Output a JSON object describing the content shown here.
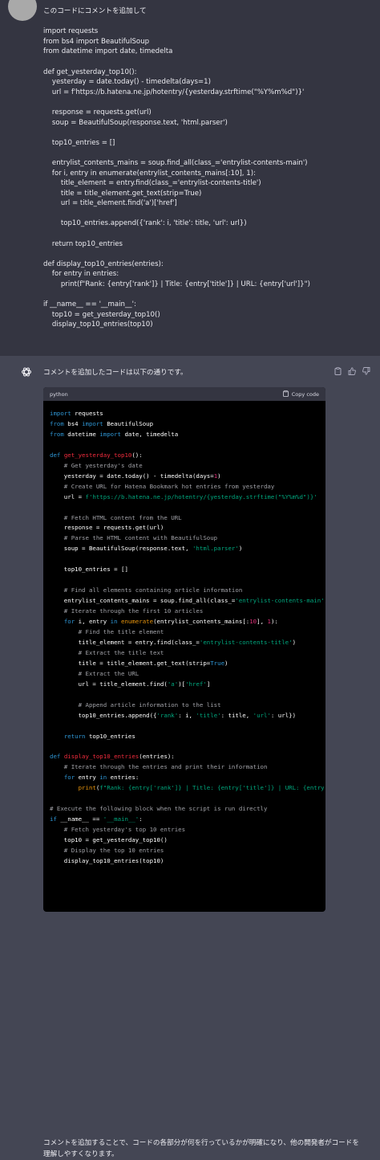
{
  "user": {
    "prompt": "このコードにコメントを追加して",
    "code_lines": [
      "import requests",
      "from bs4 import BeautifulSoup",
      "from datetime import date, timedelta",
      "",
      "def get_yesterday_top10():",
      "    yesterday = date.today() - timedelta(days=1)",
      "    url = f'https://b.hatena.ne.jp/hotentry/{yesterday.strftime(\"%Y%m%d\")}'",
      "",
      "    response = requests.get(url)",
      "    soup = BeautifulSoup(response.text, 'html.parser')",
      "",
      "    top10_entries = []",
      "",
      "    entrylist_contents_mains = soup.find_all(class_='entrylist-contents-main')",
      "    for i, entry in enumerate(entrylist_contents_mains[:10], 1):",
      "        title_element = entry.find(class_='entrylist-contents-title')",
      "        title = title_element.get_text(strip=True)",
      "        url = title_element.find('a')['href']",
      "",
      "        top10_entries.append({'rank': i, 'title': title, 'url': url})",
      "",
      "    return top10_entries",
      "",
      "def display_top10_entries(entries):",
      "    for entry in entries:",
      "        print(f\"Rank: {entry['rank']} | Title: {entry['title']} | URL: {entry['url']}\")",
      "",
      "if __name__ == '__main__':",
      "    top10 = get_yesterday_top10()",
      "    display_top10_entries(top10)"
    ]
  },
  "assistant": {
    "intro": "コメントを追加したコードは以下の通りです。",
    "code_language": "python",
    "copy_label": "Copy code",
    "outro": "コメントを追加することで、コードの各部分が何を行っているかが明確になり、他の開発者がコードを理解しやすくなります。",
    "code_lines": [
      "import requests",
      "from bs4 import BeautifulSoup",
      "from datetime import date, timedelta",
      "",
      "def get_yesterday_top10():",
      "    # Get yesterday's date",
      "    yesterday = date.today() - timedelta(days=1)",
      "    # Create URL for Hatena Bookmark hot entries from yesterday",
      "    url = f'https://b.hatena.ne.jp/hotentry/{yesterday.strftime(\"%Y%m%d\")}'",
      "",
      "    # Fetch HTML content from the URL",
      "    response = requests.get(url)",
      "    # Parse the HTML content with BeautifulSoup",
      "    soup = BeautifulSoup(response.text, 'html.parser')",
      "",
      "    top10_entries = []",
      "",
      "    # Find all elements containing article information",
      "    entrylist_contents_mains = soup.find_all(class_='entrylist-contents-main')",
      "    # Iterate through the first 10 articles",
      "    for i, entry in enumerate(entrylist_contents_mains[:10], 1):",
      "        # Find the title element",
      "        title_element = entry.find(class_='entrylist-contents-title')",
      "        # Extract the title text",
      "        title = title_element.get_text(strip=True)",
      "        # Extract the URL",
      "        url = title_element.find('a')['href']",
      "",
      "        # Append article information to the list",
      "        top10_entries.append({'rank': i, 'title': title, 'url': url})",
      "",
      "    return top10_entries",
      "",
      "def display_top10_entries(entries):",
      "    # Iterate through the entries and print their information",
      "    for entry in entries:",
      "        print(f\"Rank: {entry['rank']} | Title: {entry['title']} | URL: {entry['url']}\")",
      "",
      "# Execute the following block when the script is run directly",
      "if __name__ == '__main__':",
      "    # Fetch yesterday's top 10 entries",
      "    top10 = get_yesterday_top10()",
      "    # Display the top 10 entries",
      "    display_top10_entries(top10)"
    ]
  },
  "icons": {
    "gpt": "openai-logo-icon",
    "copy": "clipboard-icon",
    "thumbs_up": "thumbs-up-icon",
    "thumbs_down": "thumbs-down-icon"
  },
  "colors": {
    "user_bg": "#343541",
    "assistant_bg": "#444654",
    "code_bg": "#000000",
    "code_header_bg": "#343541",
    "keyword": "#2e95d3",
    "function": "#f22c3d",
    "comment": "#a0a1a7",
    "string": "#00a67d",
    "number": "#df3079",
    "builtin": "#e9950c"
  }
}
